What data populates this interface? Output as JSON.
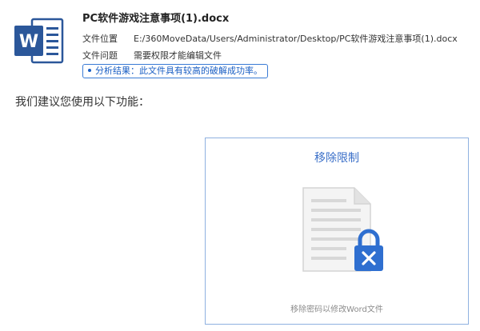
{
  "file": {
    "name": "PC软件游戏注意事项(1).docx",
    "location_label": "文件位置",
    "location_value": "E:/360MoveData/Users/Administrator/Desktop/PC软件游戏注意事项(1).docx",
    "issue_label": "文件问题",
    "issue_value": "需要权限才能编辑文件",
    "analysis_result": "分析结果：此文件具有较高的破解成功率。",
    "icon": "word-document-icon",
    "icon_letter": "W"
  },
  "suggestion": "我们建议您使用以下功能：",
  "feature_card": {
    "title": "移除限制",
    "description": "移除密码以修改Word文件",
    "icon": "locked-document-icon"
  },
  "colors": {
    "word_blue": "#2b579a",
    "accent_blue": "#3a7bd5",
    "card_border": "#8fb1e0",
    "lock_blue": "#2f6fd0"
  }
}
